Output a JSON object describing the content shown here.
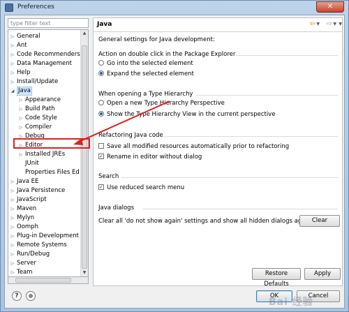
{
  "window": {
    "title": "Preferences",
    "close_label": "✕"
  },
  "filter": {
    "placeholder": "type filter text"
  },
  "tree": {
    "items": [
      {
        "label": "General",
        "level": 0,
        "expandable": true
      },
      {
        "label": "Ant",
        "level": 0,
        "expandable": true
      },
      {
        "label": "Code Recommenders",
        "level": 0,
        "expandable": true
      },
      {
        "label": "Data Management",
        "level": 0,
        "expandable": true
      },
      {
        "label": "Help",
        "level": 0,
        "expandable": true
      },
      {
        "label": "Install/Update",
        "level": 0,
        "expandable": true
      },
      {
        "label": "Java",
        "level": 0,
        "expandable": true,
        "expanded": true,
        "selected": true
      },
      {
        "label": "Appearance",
        "level": 1,
        "expandable": true
      },
      {
        "label": "Build Path",
        "level": 1,
        "expandable": true
      },
      {
        "label": "Code Style",
        "level": 1,
        "expandable": true
      },
      {
        "label": "Compiler",
        "level": 1,
        "expandable": true
      },
      {
        "label": "Debug",
        "level": 1,
        "expandable": true
      },
      {
        "label": "Editor",
        "level": 1,
        "expandable": true
      },
      {
        "label": "Installed JREs",
        "level": 1,
        "expandable": true
      },
      {
        "label": "JUnit",
        "level": 1,
        "expandable": false
      },
      {
        "label": "Properties Files Ed",
        "level": 1,
        "expandable": false
      },
      {
        "label": "Java EE",
        "level": 0,
        "expandable": true
      },
      {
        "label": "Java Persistence",
        "level": 0,
        "expandable": true
      },
      {
        "label": "JavaScript",
        "level": 0,
        "expandable": true
      },
      {
        "label": "Maven",
        "level": 0,
        "expandable": true
      },
      {
        "label": "Mylyn",
        "level": 0,
        "expandable": true
      },
      {
        "label": "Oomph",
        "level": 0,
        "expandable": true
      },
      {
        "label": "Plug-in Development",
        "level": 0,
        "expandable": true
      },
      {
        "label": "Remote Systems",
        "level": 0,
        "expandable": true
      },
      {
        "label": "Run/Debug",
        "level": 0,
        "expandable": true
      },
      {
        "label": "Server",
        "level": 0,
        "expandable": true
      },
      {
        "label": "Team",
        "level": 0,
        "expandable": true
      }
    ]
  },
  "page": {
    "title": "Java",
    "description": "General settings for Java development:",
    "double_click_group": {
      "title": "Action on double click in the Package Explorer",
      "options": [
        {
          "label": "Go into the selected element",
          "selected": false
        },
        {
          "label": "Expand the selected element",
          "selected": true
        }
      ]
    },
    "hierarchy_group": {
      "title": "When opening a Type Hierarchy",
      "options": [
        {
          "label": "Open a new Type Hierarchy Perspective",
          "selected": false
        },
        {
          "label": "Show the Type Hierarchy View in the current perspective",
          "selected": true
        }
      ]
    },
    "refactoring_group": {
      "title": "Refactoring Java code",
      "options": [
        {
          "label": "Save all modified resources automatically prior to refactoring",
          "checked": false
        },
        {
          "label": "Rename in editor without dialog",
          "checked": true
        }
      ]
    },
    "search_group": {
      "title": "Search",
      "options": [
        {
          "label": "Use reduced search menu",
          "checked": true
        }
      ]
    },
    "dialogs_group": {
      "title": "Java dialogs",
      "text": "Clear all 'do not show again' settings and show all hidden dialogs again",
      "clear_label": "Clear"
    }
  },
  "buttons": {
    "restore_defaults": "Restore Defaults",
    "apply": "Apply",
    "ok": "OK",
    "cancel": "Cancel"
  },
  "bottom": {
    "help_icon": "question-icon",
    "help_glyph": "?"
  },
  "watermark": "Bai 经验",
  "colors": {
    "highlight": "#e02020",
    "selection": "#cde8ff"
  }
}
